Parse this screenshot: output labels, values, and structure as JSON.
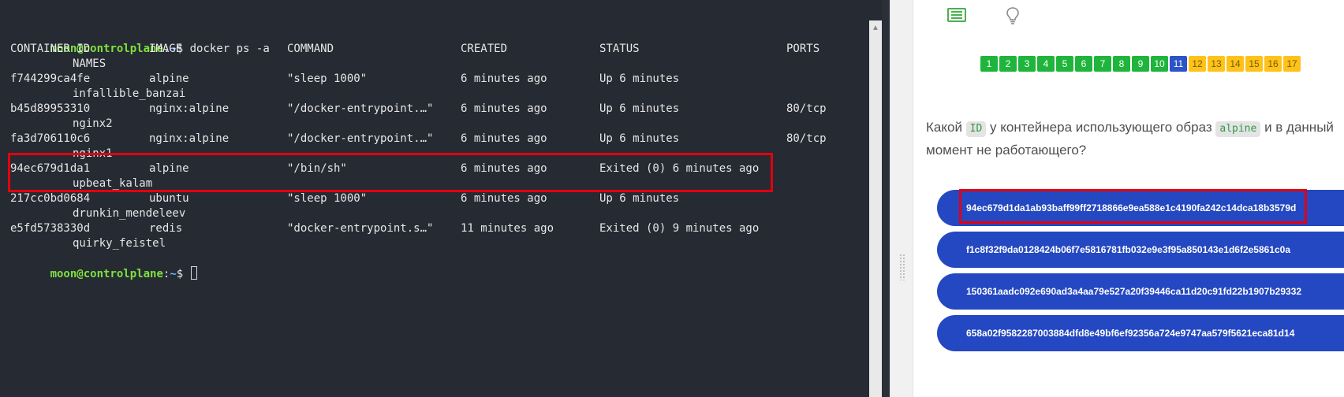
{
  "terminal": {
    "prompt_user": "moon@controlplane",
    "prompt_sep": ":",
    "prompt_path": "~",
    "prompt_symbol": "$",
    "command": "docker ps -a",
    "headers": [
      "CONTAINER ID",
      "IMAGE",
      "COMMAND",
      "CREATED",
      "STATUS",
      "PORTS",
      "NAMES"
    ],
    "rows": [
      {
        "id": "f744299ca4fe",
        "image": "alpine",
        "command": "\"sleep 1000\"",
        "created": "6 minutes ago",
        "status": "Up 6 minutes",
        "ports": "",
        "name": "infallible_banzai"
      },
      {
        "id": "b45d89953310",
        "image": "nginx:alpine",
        "command": "\"/docker-entrypoint.…\"",
        "created": "6 minutes ago",
        "status": "Up 6 minutes",
        "ports": "80/tcp",
        "name": "nginx2"
      },
      {
        "id": "fa3d706110c6",
        "image": "nginx:alpine",
        "command": "\"/docker-entrypoint.…\"",
        "created": "6 minutes ago",
        "status": "Up 6 minutes",
        "ports": "80/tcp",
        "name": "nginx1"
      },
      {
        "id": "94ec679d1da1",
        "image": "alpine",
        "command": "\"/bin/sh\"",
        "created": "6 minutes ago",
        "status": "Exited (0) 6 minutes ago",
        "ports": "",
        "name": "upbeat_kalam"
      },
      {
        "id": "217cc0bd0684",
        "image": "ubuntu",
        "command": "\"sleep 1000\"",
        "created": "6 minutes ago",
        "status": "Up 6 minutes",
        "ports": "",
        "name": "drunkin_mendeleev"
      },
      {
        "id": "e5fd5738330d",
        "image": "redis",
        "command": "\"docker-entrypoint.s…\"",
        "created": "11 minutes ago",
        "status": "Exited (0) 9 minutes ago",
        "ports": "",
        "name": "quirky_feistel"
      }
    ],
    "scroll_up_glyph": "▲"
  },
  "panel": {
    "icons": {
      "list": "list-icon",
      "hint": "lightbulb-icon"
    },
    "steps": [
      {
        "label": "1",
        "state": "done"
      },
      {
        "label": "2",
        "state": "done"
      },
      {
        "label": "3",
        "state": "done"
      },
      {
        "label": "4",
        "state": "done"
      },
      {
        "label": "5",
        "state": "done"
      },
      {
        "label": "6",
        "state": "done"
      },
      {
        "label": "7",
        "state": "done"
      },
      {
        "label": "8",
        "state": "done"
      },
      {
        "label": "9",
        "state": "done"
      },
      {
        "label": "10",
        "state": "done"
      },
      {
        "label": "11",
        "state": "current"
      },
      {
        "label": "12",
        "state": "todo"
      },
      {
        "label": "13",
        "state": "todo"
      },
      {
        "label": "14",
        "state": "todo"
      },
      {
        "label": "15",
        "state": "todo"
      },
      {
        "label": "16",
        "state": "todo"
      },
      {
        "label": "17",
        "state": "todo"
      }
    ],
    "question": {
      "part1": "Какой ",
      "chip1": "ID",
      "part2": " у контейнера использующего образ ",
      "chip2": "alpine",
      "part3": " и в данный момент не работающего?"
    },
    "answers": [
      "94ec679d1da1ab93baff99ff2718866e9ea588e1c4190fa242c14dca18b3579d",
      "f1c8f32f9da0128424b06f7e5816781fb032e9e3f95a850143e1d6f2e5861c0a",
      "150361aadc092e690ad3a4aa79e527a20f39446ca11d20c91fd22b1907b29332",
      "658a02f9582287003884dfd8e49bf6ef92356a724e9747aa579f5621eca81d14"
    ]
  },
  "colors": {
    "terminal_bg": "#262a33",
    "prompt_user": "#7ee23d",
    "prompt_path": "#6cb4ff",
    "highlight": "#e3000f",
    "step_done": "#1fb53c",
    "step_current": "#2b54c8",
    "step_todo": "#ffc21a",
    "answer_bg": "#2448c2"
  }
}
